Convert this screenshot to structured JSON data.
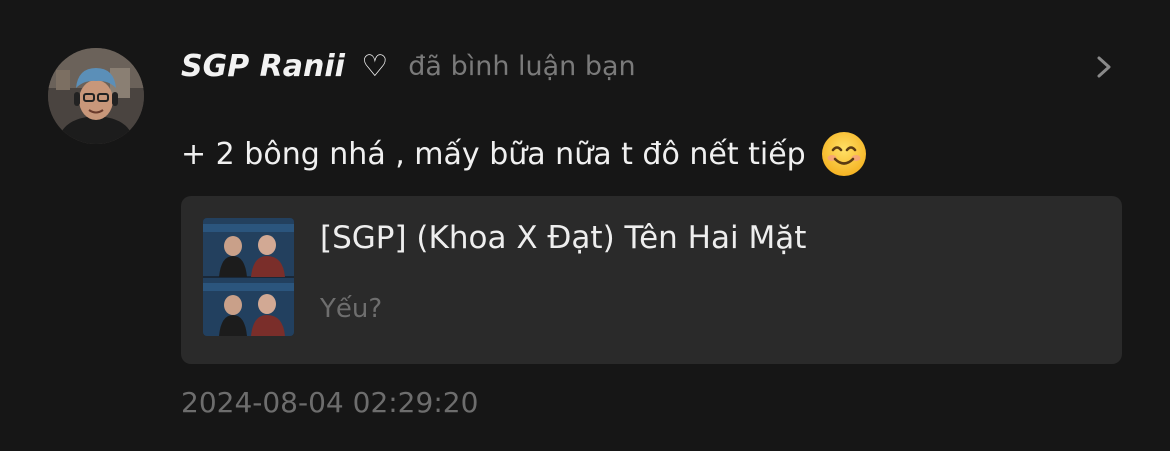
{
  "notification": {
    "username": "SGP Ranii",
    "username_heart": "♡",
    "action_text": "đã bình luận bạn",
    "comment_text": "+ 2 bông nhá , mấy bữa nữa t đô nết tiếp",
    "comment_emoji": "smiling-face-emoji",
    "timestamp": "2024-08-04 02:29:20"
  },
  "card": {
    "title": "[SGP] (Khoa X Đạt) Tên Hai Mặt",
    "subtitle": "Yếu?"
  },
  "icons": {
    "chevron": "chevron-right-icon",
    "avatar": "avatar"
  },
  "colors": {
    "background": "#161616",
    "card_background": "#2a2a2a",
    "primary_text": "#f0f0f0",
    "secondary_text": "#7a7a7a"
  }
}
